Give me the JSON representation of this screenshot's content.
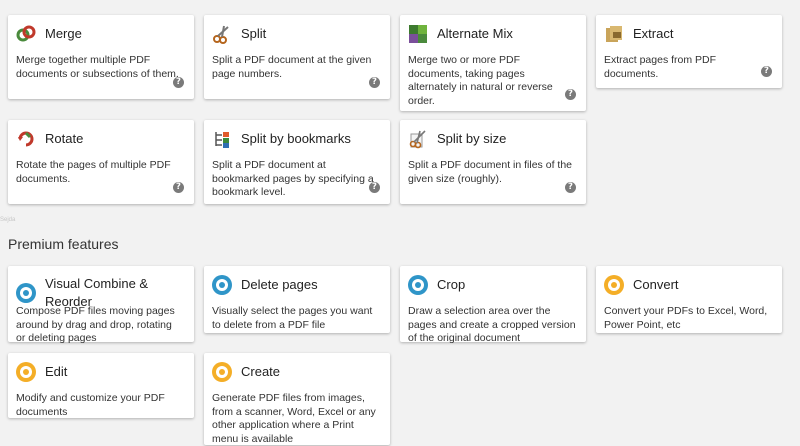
{
  "tools": [
    {
      "id": "merge",
      "title": "Merge",
      "desc": "Merge together multiple PDF documents or subsections of them.",
      "icon": "merge-icon"
    },
    {
      "id": "split",
      "title": "Split",
      "desc": "Split a PDF document at the given page numbers.",
      "icon": "scissors-icon"
    },
    {
      "id": "alternate-mix",
      "title": "Alternate Mix",
      "desc": "Merge two or more PDF documents, taking pages alternately in natural or reverse order.",
      "icon": "alternate-mix-icon"
    },
    {
      "id": "extract",
      "title": "Extract",
      "desc": "Extract pages from PDF documents.",
      "icon": "extract-icon"
    },
    {
      "id": "rotate",
      "title": "Rotate",
      "desc": "Rotate the pages of multiple PDF documents.",
      "icon": "rotate-icon"
    },
    {
      "id": "split-by-bookmarks",
      "title": "Split by bookmarks",
      "desc": "Split a PDF document at bookmarked pages by specifying a bookmark level.",
      "icon": "bookmarks-icon"
    },
    {
      "id": "split-by-size",
      "title": "Split by size",
      "desc": "Split a PDF document in files of the given size (roughly).",
      "icon": "split-size-icon"
    }
  ],
  "premium_title": "Premium features",
  "tiny_label": "Sejda",
  "premium": [
    {
      "id": "visual-combine",
      "title": "Visual Combine & Reorder",
      "desc": "Compose PDF files moving pages around by drag and drop, rotating or deleting pages",
      "icon": "sejda-blue-icon"
    },
    {
      "id": "delete-pages",
      "title": "Delete pages",
      "desc": "Visually select the pages you want to delete from a PDF file",
      "icon": "sejda-blue-icon"
    },
    {
      "id": "crop",
      "title": "Crop",
      "desc": "Draw a selection area over the pages and create a cropped version of the original document",
      "icon": "sejda-blue-icon"
    },
    {
      "id": "convert",
      "title": "Convert",
      "desc": "Convert your PDFs to Excel, Word, Power Point, etc",
      "icon": "sejda-orange-icon"
    },
    {
      "id": "edit",
      "title": "Edit",
      "desc": "Modify and customize your PDF documents",
      "icon": "sejda-orange-icon"
    },
    {
      "id": "create",
      "title": "Create",
      "desc": "Generate PDF files from images, from a scanner, Word, Excel or any other application where a Print menu is available",
      "icon": "sejda-orange-icon"
    }
  ],
  "help_glyph": "?",
  "colors": {
    "blue": "#2f95c8",
    "orange": "#f4ae27",
    "background": "#f2f2f2"
  }
}
